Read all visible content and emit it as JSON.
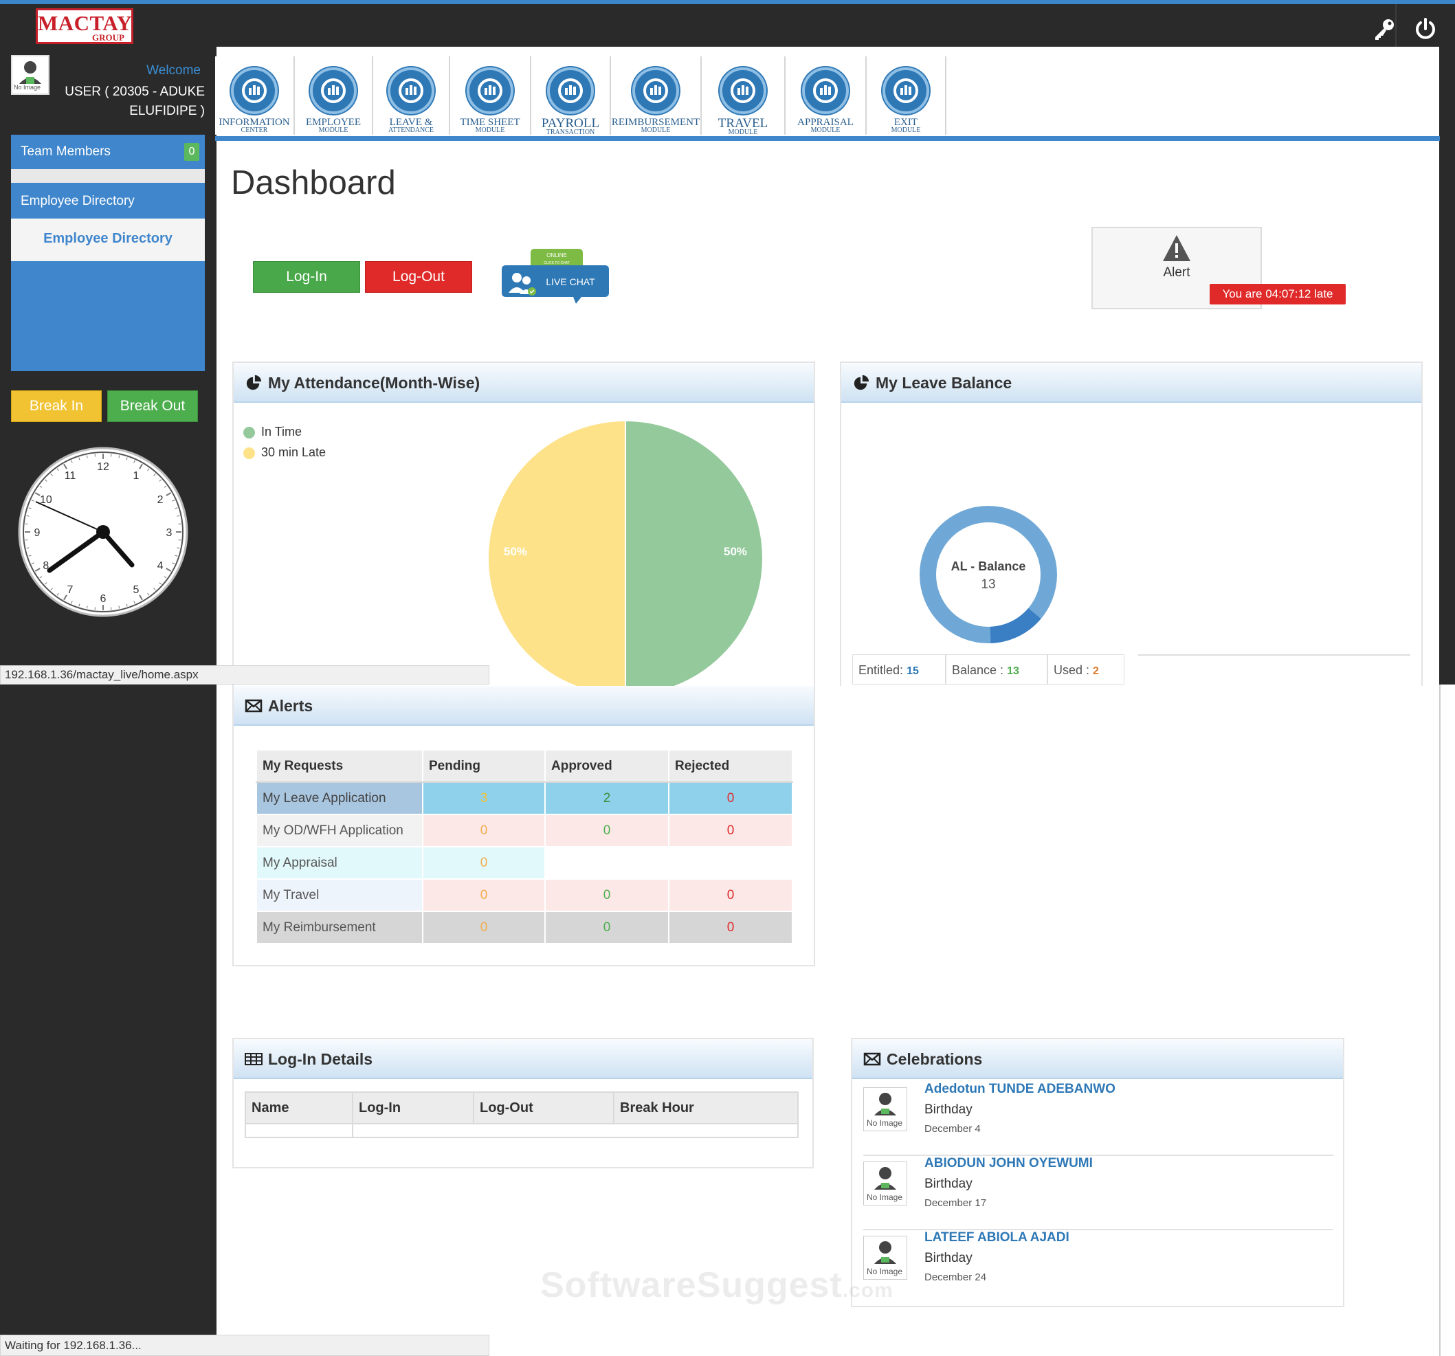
{
  "app": {
    "logo_top": "MACTAY",
    "logo_bottom": "GROUP"
  },
  "sidebar": {
    "welcome": "Welcome",
    "user_line1": "USER ( 20305 - ADUKE",
    "user_line2": "ELUFIDIPE )",
    "avatar_text": "No Image",
    "team_members": "Team Members",
    "team_members_count": "0",
    "employee_directory_header": "Employee Directory",
    "employee_directory_link": "Employee Directory",
    "break_in": "Break In",
    "break_out": "Break Out",
    "clock": {
      "numbers": [
        "12",
        "1",
        "2",
        "3",
        "4",
        "5",
        "6",
        "7",
        "8",
        "9",
        "10",
        "11"
      ]
    }
  },
  "modules": [
    {
      "label": "Information",
      "sub": "Center",
      "icon": "monitor-chart-icon"
    },
    {
      "label": "Employee",
      "sub": "Module",
      "icon": "people-gear-icon"
    },
    {
      "label": "Leave &",
      "sub": "Attendance",
      "icon": "beach-icon"
    },
    {
      "label": "Time Sheet",
      "sub": "Module",
      "icon": "monitor-chart-icon"
    },
    {
      "label": "Payroll",
      "sub": "Transaction",
      "icon": "money-bag-icon"
    },
    {
      "label": "Reimbursement",
      "sub": "Module",
      "icon": "wallet-icon"
    },
    {
      "label": "Travel",
      "sub": "Module",
      "icon": "airplane-icon"
    },
    {
      "label": "Appraisal",
      "sub": "Module",
      "icon": "bar-chart-icon"
    },
    {
      "label": "Exit",
      "sub": "Module",
      "icon": "exit-door-icon"
    }
  ],
  "main": {
    "title": "Dashboard",
    "login_button": "Log-In",
    "logout_button": "Log-Out",
    "live_chat": {
      "top": "ONLINE",
      "sub": "CLICK TO CHAT",
      "label": "LIVE CHAT"
    },
    "alert": {
      "label": "Alert",
      "late_text": "You are 04:07:12 late"
    }
  },
  "attendance": {
    "title": "My Attendance(Month-Wise)",
    "legend": [
      {
        "label": "In Time",
        "color": "#93c99b"
      },
      {
        "label": "30 min Late",
        "color": "#fde28a"
      }
    ]
  },
  "chart_data": {
    "type": "pie",
    "title": "My Attendance(Month-Wise)",
    "categories": [
      "In Time",
      "30 min Late"
    ],
    "values": [
      50,
      50
    ],
    "labels": [
      "50%",
      "50%"
    ],
    "colors": [
      "#93c99b",
      "#fde28a"
    ],
    "legend": "top-left"
  },
  "leave_balance": {
    "title": "My Leave Balance",
    "donut_label": "AL - Balance",
    "donut_value": "13",
    "entitled_label": "Entitled:",
    "entitled_value": "15",
    "balance_label": "Balance :",
    "balance_value": "13",
    "used_label": "Used :",
    "used_value": "2",
    "used_fraction": 0.1333
  },
  "status_bar_1": "192.168.1.36/mactay_live/home.aspx",
  "status_bar_2": "Waiting for 192.168.1.36...",
  "alerts": {
    "title": "Alerts",
    "headers": [
      "My Requests",
      "Pending",
      "Approved",
      "Rejected"
    ],
    "rows": [
      {
        "name": "My Leave Application",
        "pending": "3",
        "approved": "2",
        "rejected": "0"
      },
      {
        "name": "My OD/WFH Application",
        "pending": "0",
        "approved": "0",
        "rejected": "0"
      },
      {
        "name": "My Appraisal",
        "pending": "0"
      },
      {
        "name": "My Travel",
        "pending": "0",
        "approved": "0",
        "rejected": "0"
      },
      {
        "name": "My Reimbursement",
        "pending": "0",
        "approved": "0",
        "rejected": "0"
      }
    ]
  },
  "login_details": {
    "title": "Log-In Details",
    "headers": [
      "Name",
      "Log-In",
      "Log-Out",
      "Break Hour"
    ]
  },
  "celebrations": {
    "title": "Celebrations",
    "items": [
      {
        "name": "Adedotun TUNDE ADEBANWO",
        "type": "Birthday",
        "date": "December 4",
        "avatar_text": "No Image"
      },
      {
        "name": "ABIODUN JOHN OYEWUMI",
        "type": "Birthday",
        "date": "December 17",
        "avatar_text": "No Image"
      },
      {
        "name": "LATEEF ABIOLA AJADI",
        "type": "Birthday",
        "date": "December 24",
        "avatar_text": "No Image"
      }
    ]
  },
  "watermark": {
    "main": "SoftwareSuggest",
    "suffix": ".com"
  }
}
